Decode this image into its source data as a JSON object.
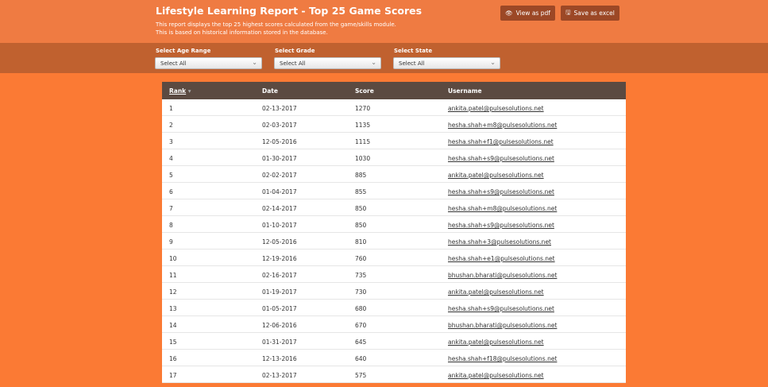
{
  "header": {
    "title": "Lifestyle Learning Report - Top 25 Game Scores",
    "description": "This report displays the top 25 highest scores calculated from the game/skills module. This is based on historical information stored in the database.",
    "view_pdf": "View as pdf",
    "save_excel": "Save as excel"
  },
  "filters": {
    "age_label": "Select Age Range",
    "age_value": "Select All",
    "grade_label": "Select Grade",
    "grade_value": "Select All",
    "state_label": "Select State",
    "state_value": "Select All"
  },
  "table": {
    "columns": [
      "Rank",
      "Date",
      "Score",
      "Username"
    ],
    "rows": [
      [
        "1",
        "02-13-2017",
        "1270",
        "ankita.patel@pulsesolutions.net"
      ],
      [
        "2",
        "02-03-2017",
        "1135",
        "hesha.shah+m8@pulsesolutions.net"
      ],
      [
        "3",
        "12-05-2016",
        "1115",
        "hesha.shah+f1@pulsesolutions.net"
      ],
      [
        "4",
        "01-30-2017",
        "1030",
        "hesha.shah+s9@pulsesolutions.net"
      ],
      [
        "5",
        "02-02-2017",
        "885",
        "ankita.patel@pulsesolutions.net"
      ],
      [
        "6",
        "01-04-2017",
        "855",
        "hesha.shah+s9@pulsesolutions.net"
      ],
      [
        "7",
        "02-14-2017",
        "850",
        "hesha.shah+m8@pulsesolutions.net"
      ],
      [
        "8",
        "01-10-2017",
        "850",
        "hesha.shah+s9@pulsesolutions.net"
      ],
      [
        "9",
        "12-05-2016",
        "810",
        "hesha.shah+3@pulsesolutions.net"
      ],
      [
        "10",
        "12-19-2016",
        "760",
        "hesha.shah+e1@pulsesolutions.net"
      ],
      [
        "11",
        "02-16-2017",
        "735",
        "bhushan.bharati@pulsesolutions.net"
      ],
      [
        "12",
        "01-19-2017",
        "730",
        "ankita.patel@pulsesolutions.net"
      ],
      [
        "13",
        "01-05-2017",
        "680",
        "hesha.shah+s9@pulsesolutions.net"
      ],
      [
        "14",
        "12-06-2016",
        "670",
        "bhushan.bharati@pulsesolutions.net"
      ],
      [
        "15",
        "01-31-2017",
        "645",
        "ankita.patel@pulsesolutions.net"
      ],
      [
        "16",
        "12-13-2016",
        "640",
        "hesha.shah+f18@pulsesolutions.net"
      ],
      [
        "17",
        "02-13-2017",
        "575",
        "ankita.patel@pulsesolutions.net"
      ]
    ]
  }
}
